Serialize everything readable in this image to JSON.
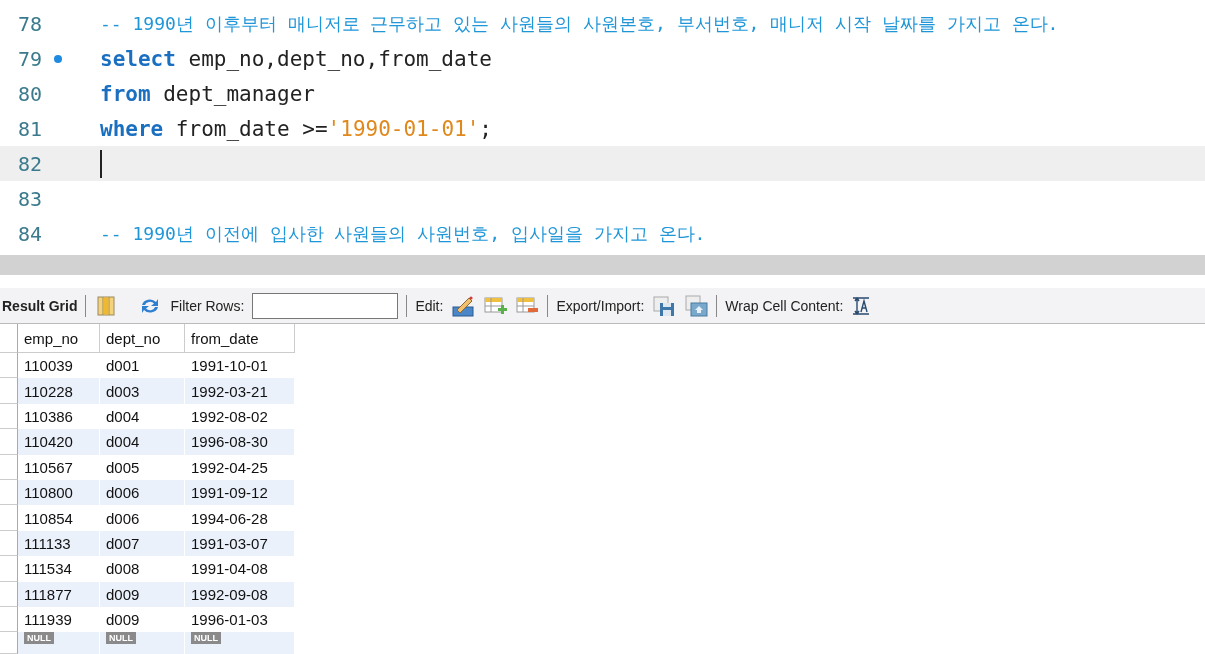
{
  "editor": {
    "lines": [
      {
        "number": "78",
        "marker": false,
        "current": false,
        "tokens": [
          {
            "kind": "comment",
            "text": "-- 1990년 이후부터 매니저로 근무하고 있는 사원들의 사원본호, 부서번호, 매니저 시작 날짜를 가지고 온다."
          }
        ]
      },
      {
        "number": "79",
        "marker": true,
        "current": false,
        "tokens": [
          {
            "kind": "keyword",
            "text": "select"
          },
          {
            "kind": "plain",
            "text": " emp_no,dept_no,from_date"
          }
        ]
      },
      {
        "number": "80",
        "marker": false,
        "current": false,
        "tokens": [
          {
            "kind": "keyword",
            "text": "from"
          },
          {
            "kind": "plain",
            "text": " dept_manager"
          }
        ]
      },
      {
        "number": "81",
        "marker": false,
        "current": false,
        "tokens": [
          {
            "kind": "keyword",
            "text": "where"
          },
          {
            "kind": "plain",
            "text": " from_date >="
          },
          {
            "kind": "string",
            "text": "'1990-01-01'"
          },
          {
            "kind": "plain",
            "text": ";"
          }
        ]
      },
      {
        "number": "82",
        "marker": false,
        "current": true
      },
      {
        "number": "83",
        "marker": false,
        "current": false
      },
      {
        "number": "84",
        "marker": false,
        "current": false,
        "tokens": [
          {
            "kind": "comment",
            "text": "-- 1990년 이전에 입사한 사원들의 사원번호, 입사일을 가지고 온다."
          }
        ]
      }
    ]
  },
  "toolbar": {
    "result_tab": "Result Grid",
    "filter_label": "Filter Rows:",
    "edit_label": "Edit:",
    "export_label": "Export/Import:",
    "wrap_label": "Wrap Cell Content:"
  },
  "grid": {
    "columns": [
      "emp_no",
      "dept_no",
      "from_date"
    ],
    "rows": [
      [
        "110039",
        "d001",
        "1991-10-01"
      ],
      [
        "110228",
        "d003",
        "1992-03-21"
      ],
      [
        "110386",
        "d004",
        "1992-08-02"
      ],
      [
        "110420",
        "d004",
        "1996-08-30"
      ],
      [
        "110567",
        "d005",
        "1992-04-25"
      ],
      [
        "110800",
        "d006",
        "1991-09-12"
      ],
      [
        "110854",
        "d006",
        "1994-06-28"
      ],
      [
        "111133",
        "d007",
        "1991-03-07"
      ],
      [
        "111534",
        "d008",
        "1991-04-08"
      ],
      [
        "111877",
        "d009",
        "1992-09-08"
      ],
      [
        "111939",
        "d009",
        "1996-01-03"
      ]
    ],
    "null_row": [
      "NULL",
      "NULL",
      "NULL"
    ]
  }
}
